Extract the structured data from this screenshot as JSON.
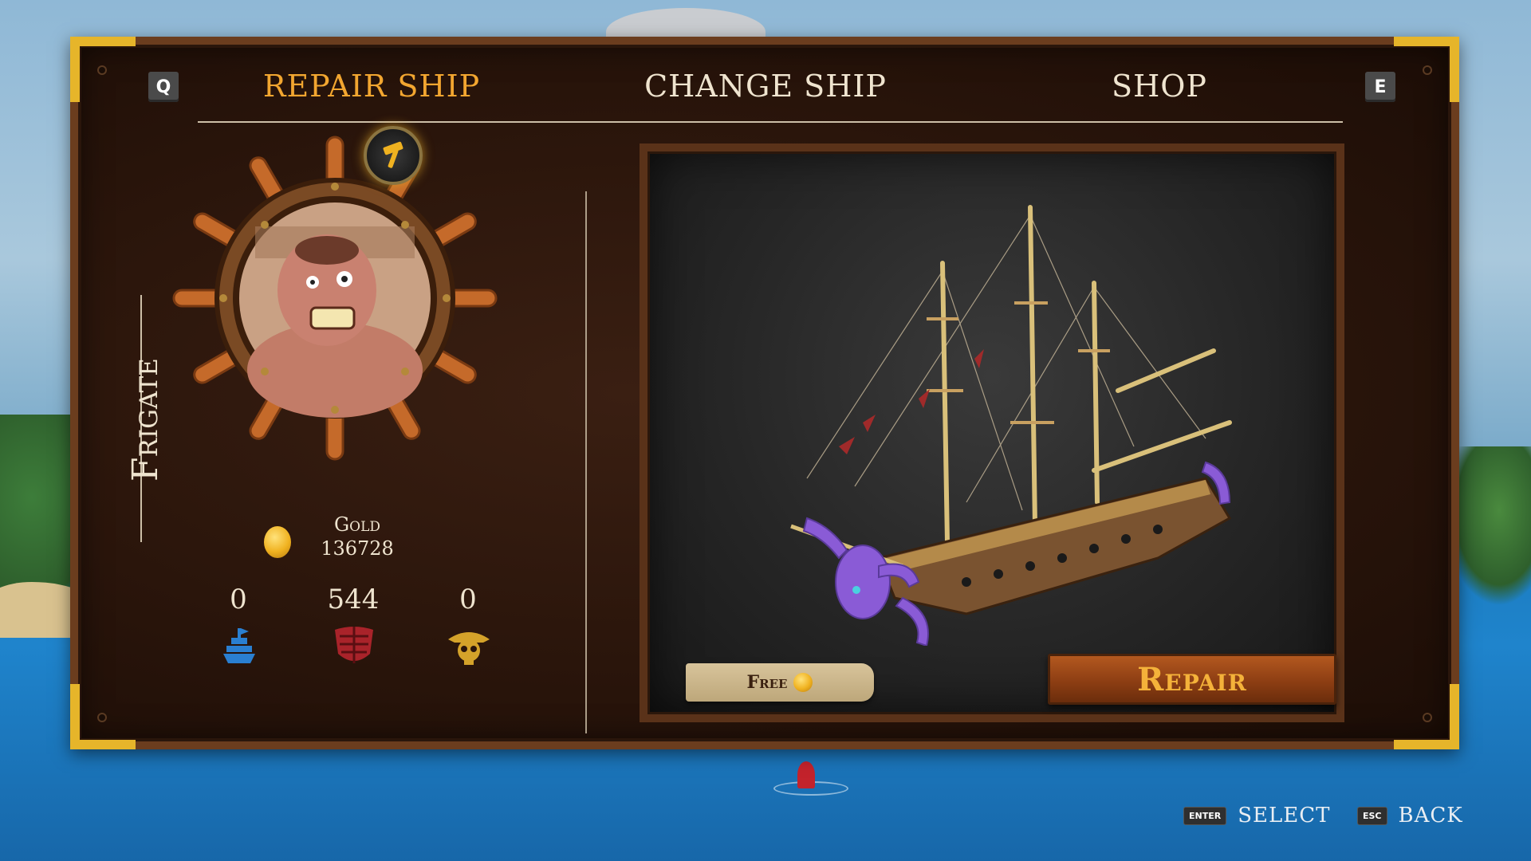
{
  "tabs": {
    "left_key": "Q",
    "right_key": "E",
    "items": [
      {
        "label": "REPAIR SHIP",
        "active": true
      },
      {
        "label": "CHANGE SHIP",
        "active": false
      },
      {
        "label": "SHOP",
        "active": false
      }
    ]
  },
  "ship": {
    "class_label": "Frigate"
  },
  "resources": {
    "gold_label": "Gold",
    "gold_value": "136728",
    "stats": [
      {
        "value": "0",
        "icon": "blue-ship-icon"
      },
      {
        "value": "544",
        "icon": "red-hull-icon"
      },
      {
        "value": "0",
        "icon": "gold-skull-icon"
      }
    ]
  },
  "actions": {
    "free_label": "Free",
    "repair_label": "Repair"
  },
  "footer": {
    "select_key": "ENTER",
    "select_label": "SELECT",
    "back_key": "ESC",
    "back_label": "BACK"
  },
  "colors": {
    "active_tab": "#f2a630",
    "inactive_tab": "#efe4cf",
    "frame_gold": "#e6b52a",
    "repair_text": "#f4b23a"
  }
}
